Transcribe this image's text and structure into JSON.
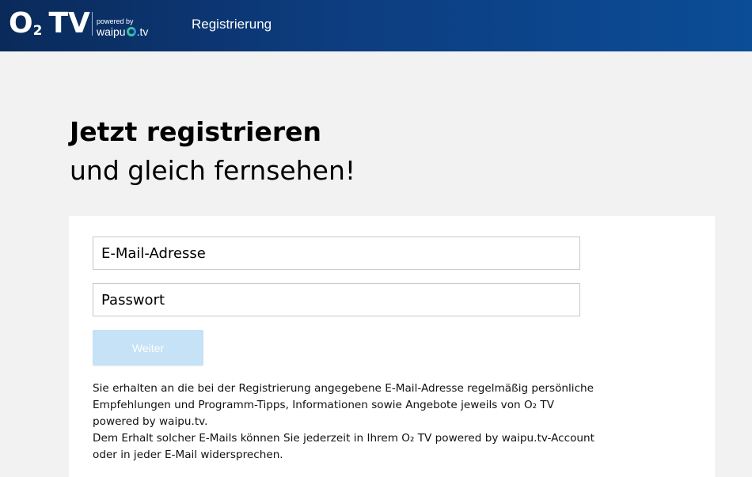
{
  "header": {
    "logo_o": "O",
    "logo_sub": "2",
    "logo_tv": "TV",
    "powered_by": "powered by",
    "waipu_left": "waipu",
    "waipu_right": ".tv",
    "nav_title": "Registrierung"
  },
  "hero": {
    "line1": "Jetzt registrieren",
    "line2": "und gleich fernsehen!"
  },
  "form": {
    "email_placeholder": "E-Mail-Adresse",
    "password_placeholder": "Passwort",
    "submit_label": "Weiter"
  },
  "info": {
    "paragraph1": "Sie erhalten an die bei der Registrierung angegebene E-Mail-Adresse regelmäßig persönliche Empfehlungen und Programm-Tipps, Informationen sowie Angebote jeweils von O₂ TV powered by waipu.tv.",
    "paragraph2": "Dem Erhalt solcher E-Mails können Sie jederzeit in Ihrem O₂ TV powered by waipu.tv-Account oder in jeder E-Mail widersprechen."
  },
  "colors": {
    "header_dark": "#0a2a5a",
    "header_light": "#0b4d97",
    "button_bg": "#c5e2f6",
    "page_bg": "#f2f2f2"
  }
}
